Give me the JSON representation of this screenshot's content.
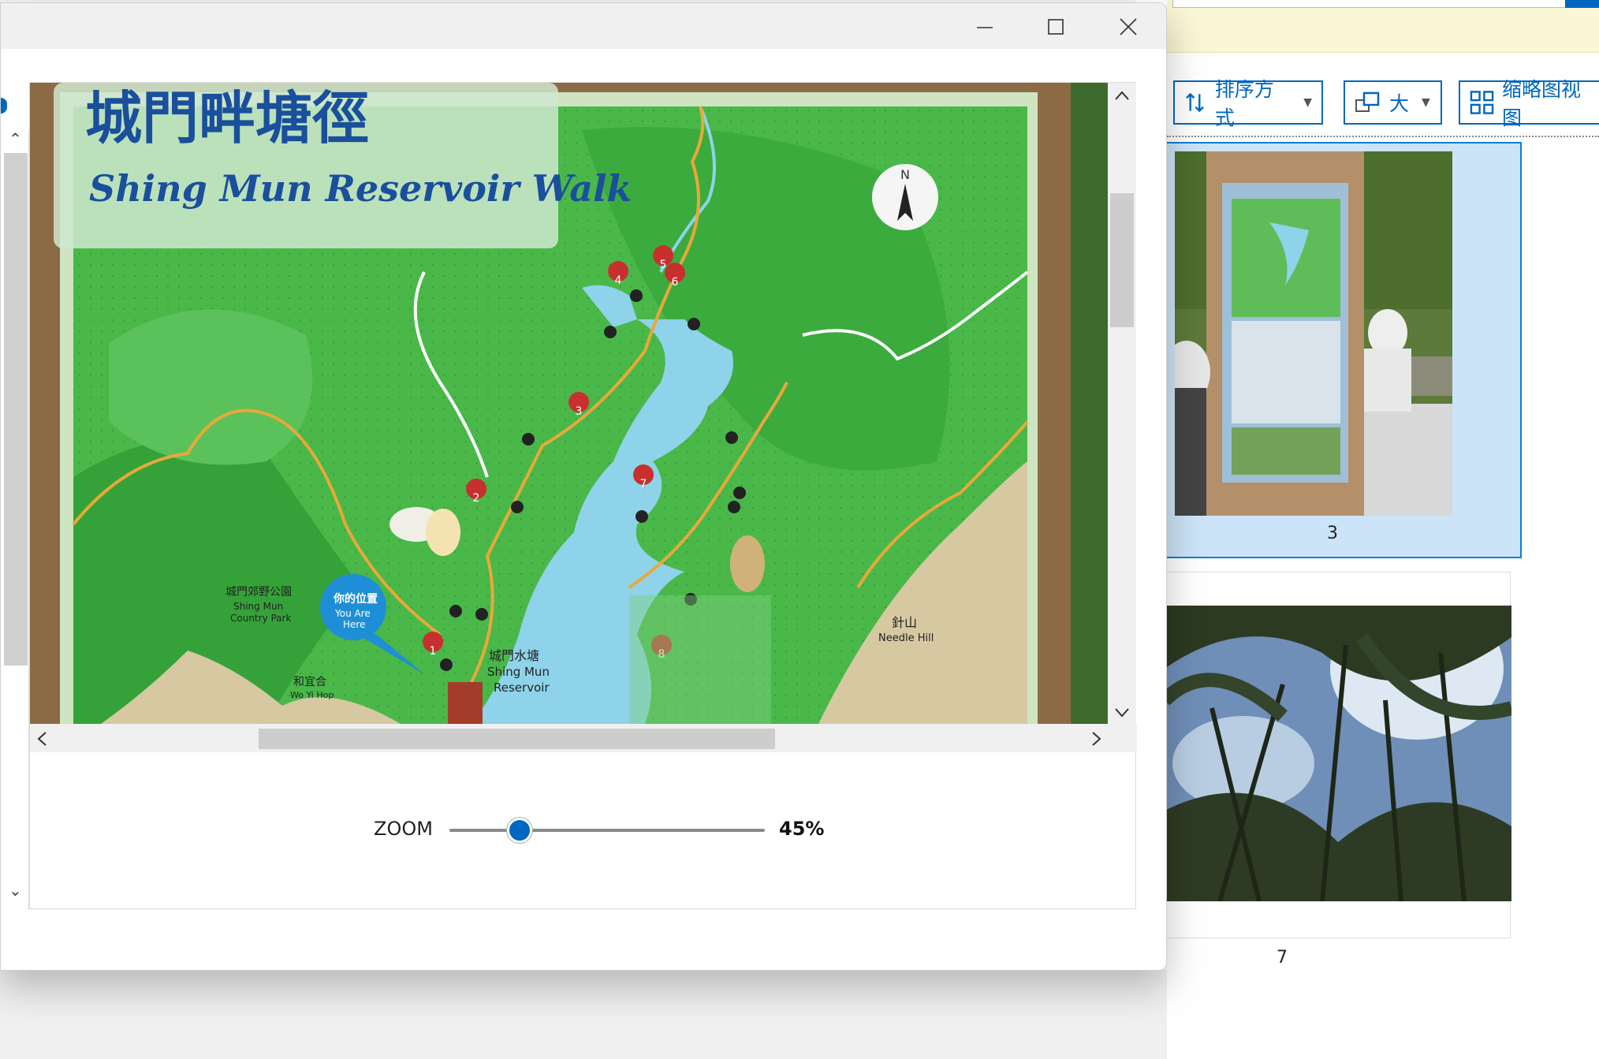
{
  "window": {
    "minimize_icon": "minimize-icon",
    "maximize_icon": "maximize-icon",
    "close_icon": "close-icon"
  },
  "image": {
    "sign_title_cn": "城門畔塘徑",
    "sign_title_en": "Shing Mun Reservoir Walk",
    "compass_letter": "N",
    "labels": [
      {
        "cn": "城門郊野公園",
        "en": "Shing Mun\nCountry Park"
      },
      {
        "cn": "城門水塘",
        "en": "Shing Mun\nReservoir"
      },
      {
        "cn": "針山",
        "en": "Needle Hill"
      },
      {
        "cn": "和宜合",
        "en": "Wo Yi Hop"
      }
    ],
    "you_are_here_cn": "你的位置",
    "you_are_here_en": "You Are\nHere",
    "markers": [
      "1",
      "2",
      "3",
      "4",
      "5",
      "6",
      "7",
      "8"
    ]
  },
  "zoom": {
    "label": "ZOOM",
    "value": "45%",
    "level": 0.45
  },
  "explorer": {
    "sort_label": "排序方式",
    "size_label": "大",
    "view_label": "缩略图视图",
    "thumbnails": [
      {
        "label": "3",
        "selected": true
      },
      {
        "label": "7",
        "selected": false
      }
    ]
  },
  "colors": {
    "accent": "#0067c0",
    "selection_bg": "#cce4f7",
    "map_green": "#49b849",
    "water": "#8ed3ea",
    "frame_brown": "#8b6a45"
  }
}
